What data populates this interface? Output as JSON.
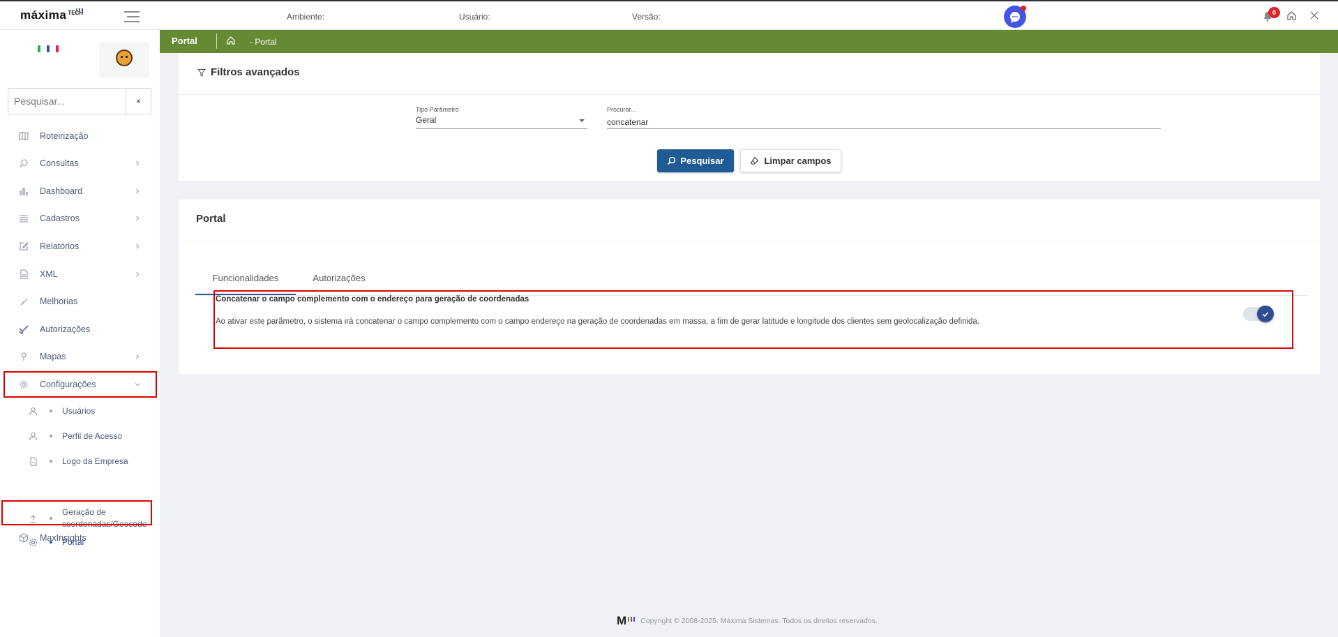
{
  "header": {
    "brand": "máxima",
    "brand_suffix": "TECH",
    "ambiente_label": "Ambiente:",
    "usuario_label": "Usuário:",
    "versao_label": "Versão:",
    "notification_count": "0"
  },
  "sidebar": {
    "search_placeholder": "Pesquisar...",
    "clear_label": "×",
    "items": [
      {
        "label": "Roteirização",
        "icon": "map-icon"
      },
      {
        "label": "Consultas",
        "icon": "search-icon"
      },
      {
        "label": "Dashboard",
        "icon": "chart-icon"
      },
      {
        "label": "Cadastros",
        "icon": "list-icon"
      },
      {
        "label": "Relatórios",
        "icon": "edit-icon"
      },
      {
        "label": "XML",
        "icon": "file-icon"
      },
      {
        "label": "Melhorias",
        "icon": "wrench-icon"
      },
      {
        "label": "Autorizações",
        "icon": "check-icon"
      },
      {
        "label": "Mapas",
        "icon": "pin-icon"
      },
      {
        "label": "Configurações",
        "icon": "gear-icon"
      },
      {
        "label": "MaxInsights",
        "icon": "cube-icon"
      }
    ],
    "subitems": [
      {
        "label": "Usuários",
        "icon": "user-icon"
      },
      {
        "label": "Perfil de Acesso",
        "icon": "user-icon"
      },
      {
        "label": "Logo da Empresa",
        "icon": "document-icon"
      },
      {
        "label": "Geração de coordenadas/Geocode",
        "icon": "upload-icon"
      },
      {
        "label": "Portal",
        "icon": "gear-icon"
      }
    ]
  },
  "breadcrumb": {
    "title": "Portal",
    "page": "- Portal"
  },
  "filters": {
    "title": "Filtros avançados",
    "tipo_label": "Tipo Parâmetro",
    "tipo_value": "Geral",
    "procurar_label": "Procurar...",
    "procurar_value": "concatenar",
    "search_button": "Pesquisar",
    "clear_button": "Limpar campos"
  },
  "portal": {
    "title": "Portal",
    "tabs": [
      "Funcionalidades",
      "Autorizações"
    ],
    "active_tab": "Funcionalidades",
    "param_title": "Concatenar o campo complemento com o endereço para geração de coordenadas",
    "param_description": "Ao ativar este parâmetro, o sistema irá concatenar o campo complemento com o campo endereço na geração de coordenadas em massa, a fim de gerar latitude e longitude dos clientes sem geolocalização definida.",
    "toggle_on": true
  },
  "footer": {
    "logo_letter": "M",
    "copyright": "Copyright © 2008-2025. Máxima Sistemas. Todos os direitos reservados."
  },
  "colors": {
    "green_bar": "#668a33",
    "primary_button": "#1f5c96",
    "highlight": "#e00000",
    "chat_button": "#4356e2"
  }
}
